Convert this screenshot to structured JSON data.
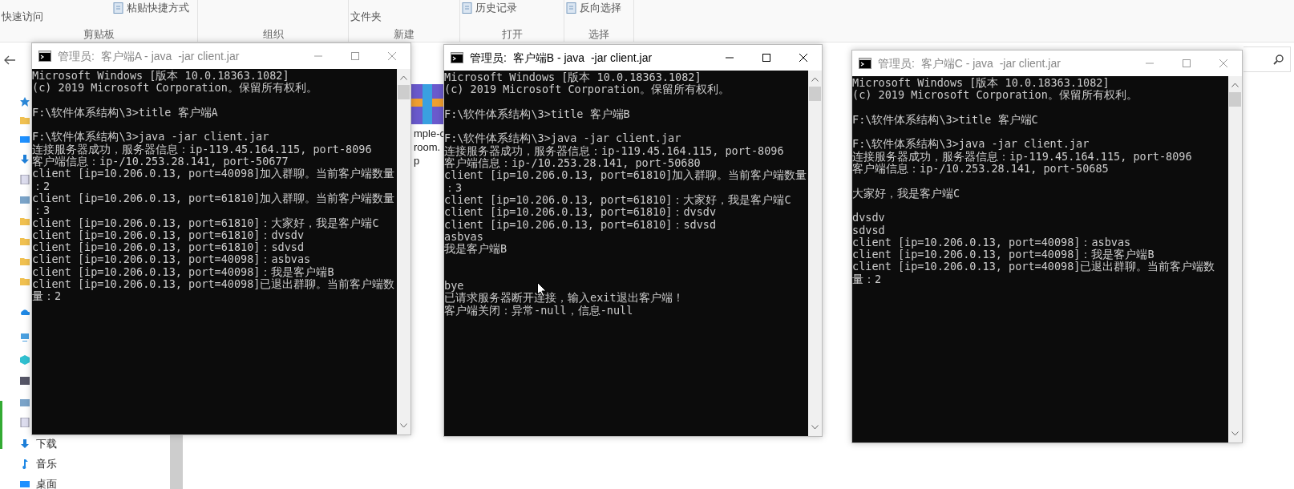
{
  "ribbon": {
    "groups": [
      {
        "label": "剪贴板",
        "items": [
          {
            "kind": "text",
            "label": "快速访问"
          },
          {
            "kind": "icon",
            "label": "粘贴快捷方式"
          }
        ]
      },
      {
        "label": "组织"
      },
      {
        "label": "新建",
        "items": [
          {
            "kind": "text",
            "label": "文件夹"
          }
        ]
      },
      {
        "label": "打开",
        "items": [
          {
            "kind": "icon",
            "label": "历史记录"
          }
        ]
      },
      {
        "label": "选择",
        "items": [
          {
            "kind": "icon",
            "label": "反向选择"
          }
        ]
      }
    ]
  },
  "nav": {
    "items": [
      {
        "label": "下载"
      },
      {
        "label": "音乐"
      },
      {
        "label": "桌面"
      }
    ]
  },
  "file": {
    "name_lines": [
      "mple-c",
      "room.",
      "p"
    ]
  },
  "windows": [
    {
      "title": "管理员:  客户端A - java  -jar client.jar",
      "active": false,
      "blocks": [
        {
          "lines": [
            "Microsoft Windows [版本 10.0.18363.1082]",
            "(c) 2019 Microsoft Corporation。保留所有权利。"
          ]
        },
        {
          "lines": [
            "F:\\软件体系结构\\3>title 客户端A"
          ]
        },
        {
          "lines": [
            "F:\\软件体系结构\\3>java -jar client.jar",
            "连接服务器成功，服务器信息：ip-119.45.164.115, port-8096",
            "客户端信息：ip-/10.253.28.141, port-50677",
            "client [ip=10.206.0.13, port=40098]加入群聊。当前客户端数量",
            "：2",
            "client [ip=10.206.0.13, port=61810]加入群聊。当前客户端数量",
            "：3",
            "client [ip=10.206.0.13, port=61810]：大家好，我是客户端C",
            "client [ip=10.206.0.13, port=61810]：dvsdv",
            "client [ip=10.206.0.13, port=61810]：sdvsd",
            "client [ip=10.206.0.13, port=40098]：asbvas",
            "client [ip=10.206.0.13, port=40098]：我是客户端B",
            "client [ip=10.206.0.13, port=40098]已退出群聊。当前客户端数",
            "量：2"
          ]
        }
      ]
    },
    {
      "title": "管理员:  客户端B - java  -jar client.jar",
      "active": true,
      "blocks": [
        {
          "lines": [
            "Microsoft Windows [版本 10.0.18363.1082]",
            "(c) 2019 Microsoft Corporation。保留所有权利。"
          ]
        },
        {
          "lines": [
            "F:\\软件体系结构\\3>title 客户端B"
          ]
        },
        {
          "lines": [
            "F:\\软件体系结构\\3>java -jar client.jar",
            "连接服务器成功，服务器信息：ip-119.45.164.115, port-8096",
            "客户端信息：ip-/10.253.28.141, port-50680",
            "client [ip=10.206.0.13, port=61810]加入群聊。当前客户端数量",
            "：3",
            "client [ip=10.206.0.13, port=61810]：大家好，我是客户端C",
            "client [ip=10.206.0.13, port=61810]：dvsdv",
            "client [ip=10.206.0.13, port=61810]：sdvsd",
            "asbvas",
            "我是客户端B"
          ]
        },
        {
          "wide_gap": true,
          "lines": [
            "bye",
            "已请求服务器断开连接，输入exit退出客户端！",
            "客户端关闭：异常-null，信息-null"
          ]
        }
      ]
    },
    {
      "title": "管理员:  客户端C - java  -jar client.jar",
      "active": false,
      "blocks": [
        {
          "lines": [
            "Microsoft Windows [版本 10.0.18363.1082]",
            "(c) 2019 Microsoft Corporation。保留所有权利。"
          ]
        },
        {
          "lines": [
            "F:\\软件体系结构\\3>title 客户端C"
          ]
        },
        {
          "lines": [
            "F:\\软件体系结构\\3>java -jar client.jar",
            "连接服务器成功，服务器信息：ip-119.45.164.115, port-8096",
            "客户端信息：ip-/10.253.28.141, port-50685"
          ]
        },
        {
          "lines": [
            "大家好，我是客户端C"
          ]
        },
        {
          "lines": [
            "dvsdv",
            "sdvsd",
            "client [ip=10.206.0.13, port=40098]：asbvas",
            "client [ip=10.206.0.13, port=40098]：我是客户端B",
            "client [ip=10.206.0.13, port=40098]已退出群聊。当前客户端数",
            "量：2"
          ]
        }
      ]
    }
  ]
}
